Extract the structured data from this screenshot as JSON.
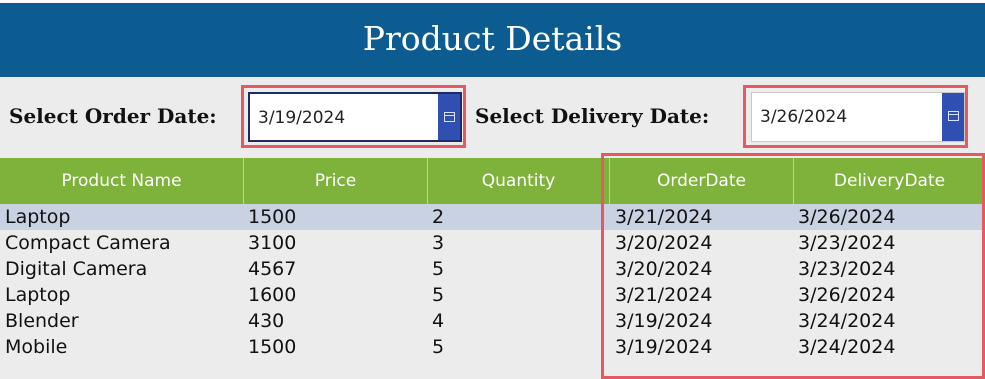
{
  "header": {
    "title": "Product Details"
  },
  "filters": {
    "order_date_label": "Select Order Date:",
    "order_date_value": "3/19/2024",
    "delivery_date_label": "Select Delivery Date:",
    "delivery_date_value": "3/26/2024"
  },
  "table": {
    "columns": [
      "Product Name",
      "Price",
      "Quantity",
      "OrderDate",
      "DeliveryDate"
    ],
    "rows": [
      [
        "Laptop",
        "1500",
        "2",
        "3/21/2024",
        "3/26/2024"
      ],
      [
        "Compact Camera",
        "3100",
        "3",
        "3/20/2024",
        "3/23/2024"
      ],
      [
        "Digital Camera",
        "4567",
        "5",
        "3/20/2024",
        "3/23/2024"
      ],
      [
        "Laptop",
        "1600",
        "5",
        "3/21/2024",
        "3/26/2024"
      ],
      [
        "Blender",
        "430",
        "4",
        "3/19/2024",
        "3/24/2024"
      ],
      [
        "Mobile",
        "1500",
        "5",
        "3/19/2024",
        "3/24/2024"
      ]
    ],
    "selected_row": 0
  },
  "colors": {
    "title_bar": "#0d5c91",
    "header_green": "#7fb23a",
    "highlight_red": "#e55a5f",
    "selected_row": "#c9d2e2",
    "calendar_button": "#2f4fb2"
  },
  "icons": {
    "calendar": "calendar-icon"
  }
}
